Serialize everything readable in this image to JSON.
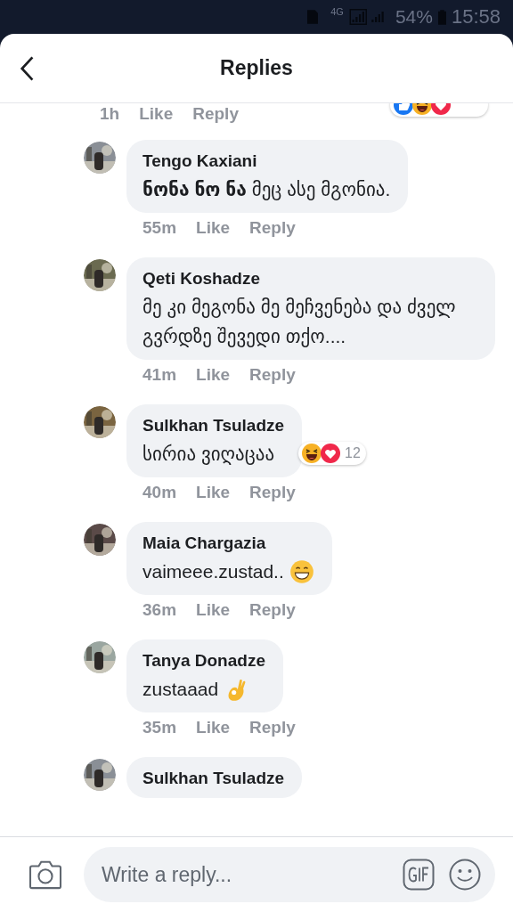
{
  "status_bar": {
    "network": "4G",
    "battery": "54%",
    "time": "15:58"
  },
  "header": {
    "title": "Replies"
  },
  "parent_meta": {
    "time": "1h",
    "like": "Like",
    "reply": "Reply",
    "reactions": [
      {
        "kind": "like"
      },
      {
        "kind": "haha"
      },
      {
        "kind": "love"
      }
    ]
  },
  "comments": [
    {
      "name": "Tengo Kaxiani",
      "text": "**ნონა ნო ნა** მეც ასე მგონია.",
      "time": "55m",
      "like": "Like",
      "reply": "Reply"
    },
    {
      "name": "Qeti Koshadze",
      "text": "მე კი მეგონა მე მეჩვენება და ძველ გვრდზე შევედი თქო....",
      "time": "41m",
      "like": "Like",
      "reply": "Reply"
    },
    {
      "name": "Sulkhan Tsuladze",
      "text": "სირია ვიღაცაა",
      "time": "40m",
      "like": "Like",
      "reply": "Reply",
      "reactions": [
        {
          "kind": "haha"
        },
        {
          "kind": "love"
        }
      ],
      "reaction_count": "12"
    },
    {
      "name": "Maia Chargazia",
      "text": "vaimeee.zustad..",
      "emoji": {
        "kind": "grin"
      },
      "time": "36m",
      "like": "Like",
      "reply": "Reply"
    },
    {
      "name": "Tanya Donadze",
      "text": "zustaaad",
      "emoji": {
        "kind": "ok"
      },
      "time": "35m",
      "like": "Like",
      "reply": "Reply"
    },
    {
      "name": "Sulkhan Tsuladze"
    }
  ],
  "composer": {
    "placeholder": "Write a reply..."
  }
}
